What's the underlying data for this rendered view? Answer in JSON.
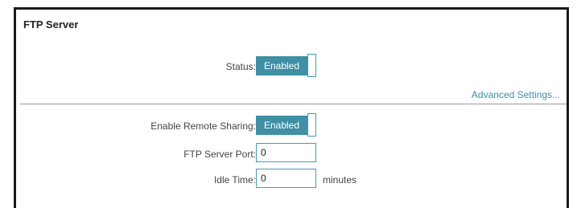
{
  "section": {
    "title": "FTP Server"
  },
  "status": {
    "label": "Status:",
    "value": "Enabled"
  },
  "advanced_link": "Advanced Settings...",
  "remote_sharing": {
    "label": "Enable Remote Sharing:",
    "value": "Enabled"
  },
  "ftp_port": {
    "label": "FTP Server Port:",
    "value": "0"
  },
  "idle_time": {
    "label": "Idle Time:",
    "value": "0",
    "unit": "minutes"
  },
  "colors": {
    "accent": "#3f8fa5",
    "frame": "#1a1a1a"
  }
}
